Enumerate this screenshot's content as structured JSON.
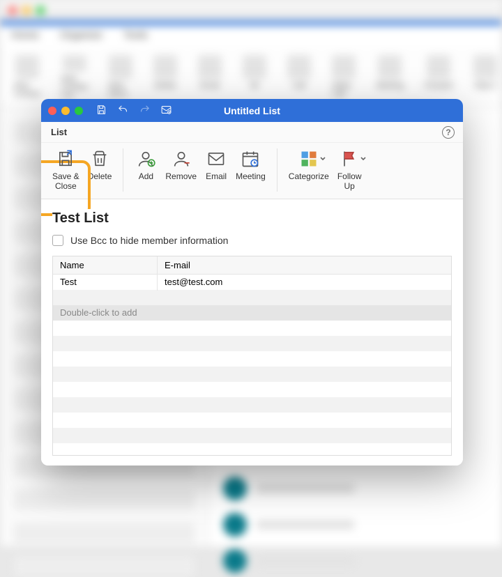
{
  "background": {
    "tabs": [
      "Home",
      "Organize",
      "Tools"
    ],
    "ribbon_items": [
      "New Contact",
      "New Contact List",
      "New Items",
      "Delete",
      "Email",
      "IM",
      "Call",
      "Video Call",
      "Meeting",
      "Forward",
      "Map It",
      "Categorize"
    ]
  },
  "modal": {
    "title": "Untitled List",
    "ribbon_tab": "List",
    "help_tooltip": "?",
    "buttons": {
      "save_close": "Save &\nClose",
      "delete": "Delete",
      "add": "Add",
      "remove": "Remove",
      "email": "Email",
      "meeting": "Meeting",
      "categorize": "Categorize",
      "follow_up": "Follow\nUp"
    },
    "list_name": "Test List",
    "bcc_label": "Use Bcc to hide member information",
    "columns": {
      "name": "Name",
      "email": "E-mail"
    },
    "rows": [
      {
        "name": "Test",
        "email": "test@test.com"
      }
    ],
    "add_placeholder": "Double-click to add"
  }
}
